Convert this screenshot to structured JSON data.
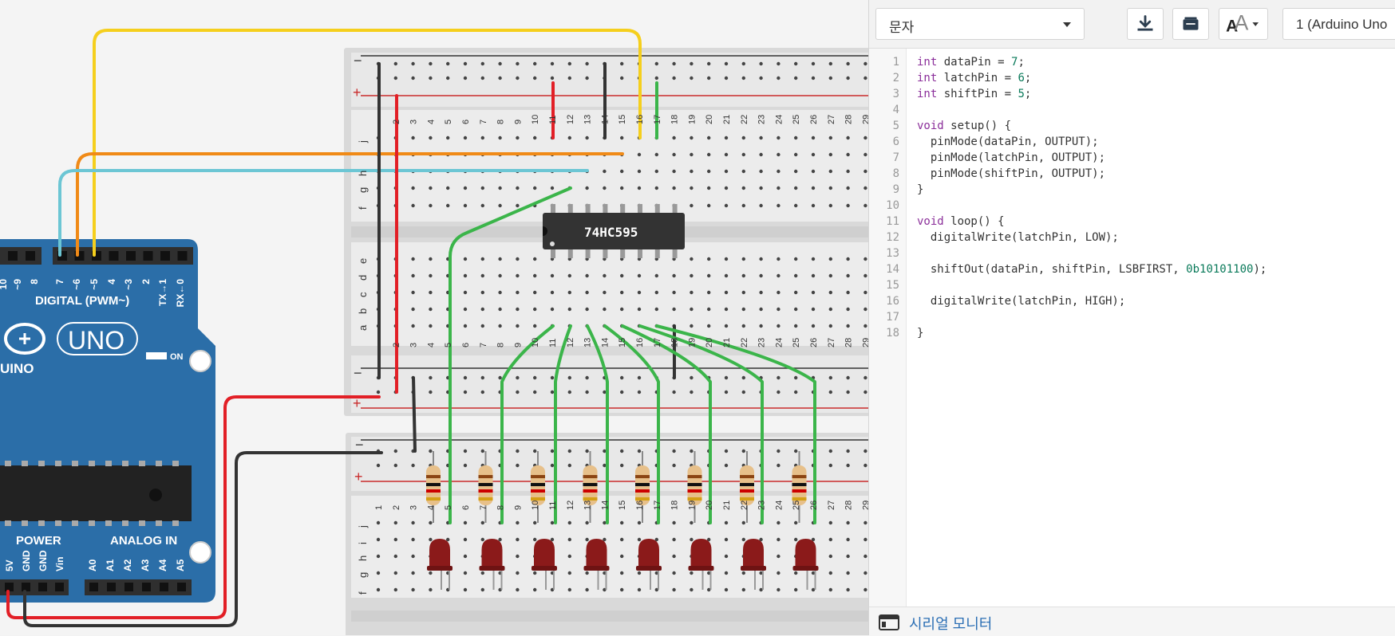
{
  "canvas": {
    "arduino": {
      "header_label": "DIGITAL (PWM~)",
      "pin_labels_top": [
        "10",
        "~9",
        "8",
        "7",
        "~6",
        "~5",
        "4",
        "~3",
        "2",
        "TX→1",
        "RX←0"
      ],
      "logo_text": "UNO",
      "brand_text": "UINO",
      "on_label": "ON",
      "power_label": "POWER",
      "analog_label": "ANALOG IN",
      "power_pins": [
        "5V",
        "GND",
        "GND",
        "Vin"
      ],
      "analog_pins": [
        "A0",
        "A1",
        "A2",
        "A3",
        "A4",
        "A5"
      ]
    },
    "chip_label": "74HC595",
    "breadboard_top": {
      "rail_minus": "−",
      "rail_plus": "+",
      "row_letters_upper": [
        "j",
        "h",
        "g",
        "f"
      ],
      "row_letters_lower": [
        "e",
        "d",
        "c",
        "b",
        "a"
      ],
      "column_numbers": [
        "2",
        "3",
        "4",
        "5",
        "6",
        "7",
        "8",
        "9",
        "10",
        "11",
        "12",
        "13",
        "14",
        "15",
        "16",
        "17",
        "18",
        "19",
        "20",
        "21",
        "22",
        "23",
        "24",
        "25",
        "26",
        "27",
        "28",
        "29"
      ]
    },
    "breadboard_bottom": {
      "rail_minus": "−",
      "rail_plus": "+",
      "row_letters": [
        "j",
        "i",
        "h",
        "g",
        "f"
      ],
      "column_numbers": [
        "1",
        "2",
        "3",
        "4",
        "5",
        "6",
        "7",
        "8",
        "9",
        "10",
        "11",
        "12",
        "13",
        "14",
        "15",
        "16",
        "17",
        "18",
        "19",
        "20",
        "21",
        "22",
        "23",
        "24",
        "25",
        "26",
        "27",
        "28",
        "29"
      ]
    },
    "colors": {
      "wire_yellow": "#f5cf1d",
      "wire_orange": "#f08a17",
      "wire_cyan": "#6cc6d4",
      "wire_green": "#3bb54a",
      "wire_red": "#e21f26",
      "wire_black": "#333333",
      "arduino_blue": "#2b6ea8",
      "led_red": "#8b1a1a"
    }
  },
  "toolbar": {
    "mode_label": "문자",
    "download_icon": "download-icon",
    "library_icon": "library-icon",
    "font_icon": "font-size-icon",
    "device_label": "1 (Arduino Uno"
  },
  "editor": {
    "lines": [
      {
        "n": "1",
        "text": "int dataPin = 7;"
      },
      {
        "n": "2",
        "text": "int latchPin = 6;"
      },
      {
        "n": "3",
        "text": "int shiftPin = 5;"
      },
      {
        "n": "4",
        "text": ""
      },
      {
        "n": "5",
        "text": "void setup() {"
      },
      {
        "n": "6",
        "text": "  pinMode(dataPin, OUTPUT);"
      },
      {
        "n": "7",
        "text": "  pinMode(latchPin, OUTPUT);"
      },
      {
        "n": "8",
        "text": "  pinMode(shiftPin, OUTPUT);"
      },
      {
        "n": "9",
        "text": "}"
      },
      {
        "n": "10",
        "text": ""
      },
      {
        "n": "11",
        "text": "void loop() {"
      },
      {
        "n": "12",
        "text": "  digitalWrite(latchPin, LOW);"
      },
      {
        "n": "13",
        "text": ""
      },
      {
        "n": "14",
        "text": "  shiftOut(dataPin, shiftPin, LSBFIRST, 0b10101100);"
      },
      {
        "n": "15",
        "text": ""
      },
      {
        "n": "16",
        "text": "  digitalWrite(latchPin, HIGH);"
      },
      {
        "n": "17",
        "text": ""
      },
      {
        "n": "18",
        "text": "}"
      }
    ]
  },
  "serial_monitor": {
    "icon": "serial-monitor-icon",
    "label": "시리얼 모니터"
  }
}
